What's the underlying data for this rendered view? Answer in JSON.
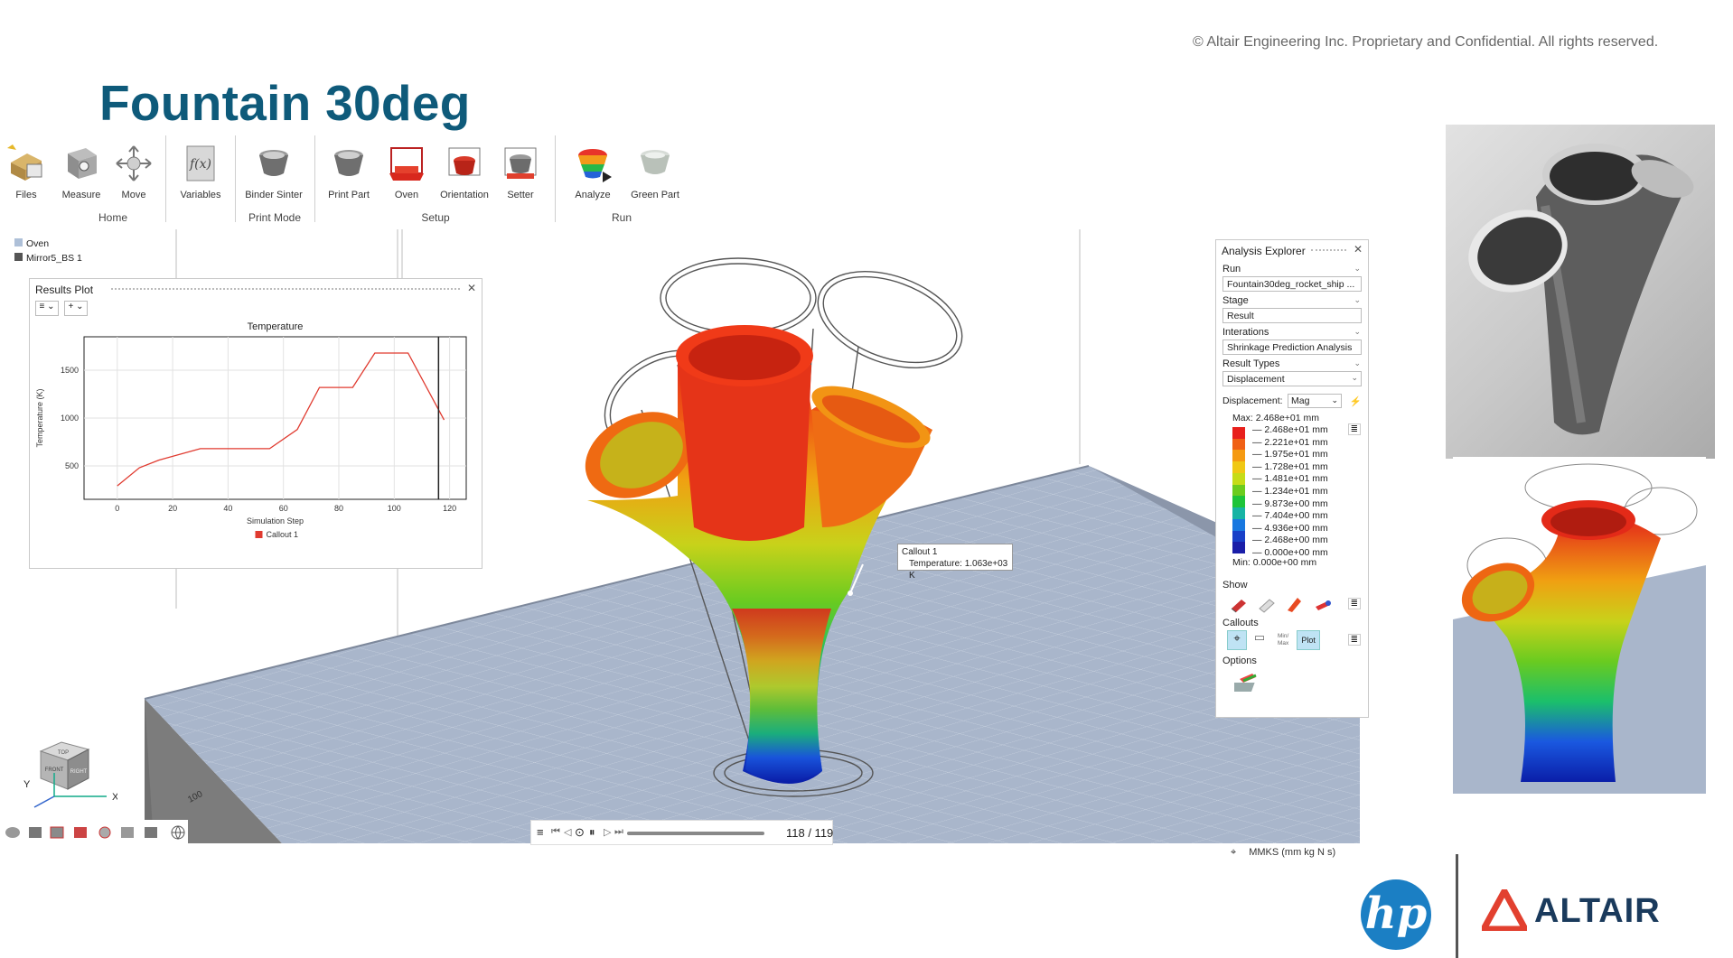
{
  "copyright": "© Altair Engineering Inc. Proprietary and Confidential. All rights reserved.",
  "title": "Fountain 30deg",
  "ribbon": {
    "groups": [
      {
        "label": "Home",
        "items": [
          "Files",
          "Measure",
          "Move"
        ]
      },
      {
        "label": "",
        "items": [
          "Variables"
        ]
      },
      {
        "label": "Print Mode",
        "items": [
          "Binder Sinter"
        ]
      },
      {
        "label": "Setup",
        "items": [
          "Print Part",
          "Oven",
          "Orientation",
          "Setter"
        ]
      },
      {
        "label": "Run",
        "items": [
          "Analyze",
          "Green Part"
        ]
      }
    ]
  },
  "model_browser": {
    "items": [
      "Oven",
      "Mirror5_BS 1"
    ]
  },
  "results_plot": {
    "header": "Results Plot",
    "plot_title": "Temperature",
    "xlabel": "Simulation Step",
    "ylabel": "Temperature (K)",
    "legend": "Callout 1",
    "x_ticks": [
      "0",
      "20",
      "40",
      "60",
      "80",
      "100",
      "120"
    ],
    "y_ticks": [
      "500",
      "1000",
      "1500"
    ],
    "chart_data": {
      "type": "line",
      "x": [
        0,
        8,
        15,
        30,
        45,
        55,
        65,
        73,
        85,
        93,
        105,
        118
      ],
      "y": [
        290,
        480,
        560,
        680,
        680,
        680,
        880,
        1320,
        1320,
        1680,
        1680,
        980
      ],
      "xlim": [
        -12,
        126
      ],
      "ylim": [
        150,
        1850
      ],
      "color": "#e03a2f",
      "cursor_x": 116
    }
  },
  "callout": {
    "title": "Callout 1",
    "text": "Temperature: 1.063e+03 K"
  },
  "analysis_explorer": {
    "header": "Analysis Explorer",
    "run_label": "Run",
    "run_value": "Fountain30deg_rocket_ship ...",
    "stage_label": "Stage",
    "stage_value": "Result",
    "interactions_label": "Interations",
    "interactions_value": "Shrinkage Prediction Analysis",
    "result_types_label": "Result Types",
    "result_type_value": "Displacement",
    "displacement_label": "Displacement:",
    "displacement_mode": "Mag",
    "max_label": "Max:",
    "max_value": "2.468e+01 mm",
    "min_label": "Min:",
    "min_value": "0.000e+00 mm",
    "legend_values": [
      "2.468e+01 mm",
      "2.221e+01 mm",
      "1.975e+01 mm",
      "1.728e+01 mm",
      "1.481e+01 mm",
      "1.234e+01 mm",
      "9.873e+00 mm",
      "7.404e+00 mm",
      "4.936e+00 mm",
      "2.468e+00 mm",
      "0.000e+00 mm"
    ],
    "legend_colors": [
      "#e8201c",
      "#f06015",
      "#f59a12",
      "#f0c814",
      "#c6dc18",
      "#6ccc1e",
      "#1ec43a",
      "#17b4a4",
      "#1878e0",
      "#1840c8",
      "#1a1ea8"
    ],
    "show_label": "Show",
    "callouts_label": "Callouts",
    "minmax_label": "Min/ Max",
    "plot_label": "Plot",
    "options_label": "Options"
  },
  "playbar": {
    "frame": "118 / 119"
  },
  "units": "MMKS (mm kg N s)",
  "viewcube": {
    "top": "TOP",
    "front": "FRONT",
    "right": "RIGHT",
    "axis_x": "X",
    "axis_y": "Y"
  },
  "grid_label": "100",
  "logos": {
    "hp": "hp",
    "altair": "ALTAIR"
  }
}
